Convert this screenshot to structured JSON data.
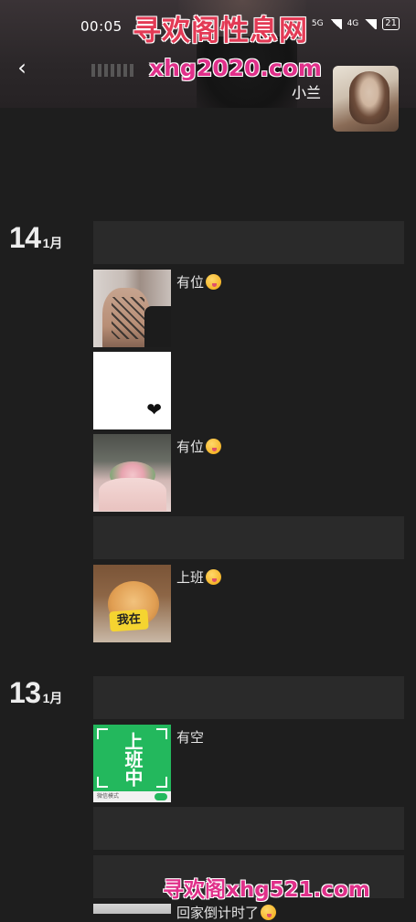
{
  "status_bar": {
    "time": "00:05",
    "net1": "5G",
    "net2": "4G",
    "battery": "21"
  },
  "watermark": {
    "top_title": "寻欢阁性息网",
    "top_url": "xhg2020.com",
    "bottom": "寻欢阁xhg521.com"
  },
  "profile": {
    "name": "小兰"
  },
  "timeline": [
    {
      "day": "14",
      "month": "1月"
    },
    {
      "day": "13",
      "month": "1月"
    }
  ],
  "posts": [
    {
      "caption": "有位",
      "emoji": "wink-face"
    },
    {
      "caption": "",
      "emoji": ""
    },
    {
      "caption": "有位",
      "emoji": "wink-face"
    },
    {
      "caption": "上班",
      "emoji": "wink-face"
    },
    {
      "caption": "有空",
      "emoji": ""
    },
    {
      "caption": "回家倒计时了",
      "emoji": "wink-face"
    }
  ],
  "thumb_text": {
    "cat_tag": "我在",
    "green_text": "上班中",
    "green_footer": "微信模式"
  },
  "icons": {
    "back": "back-arrow-icon",
    "heart": "heart-icon"
  }
}
